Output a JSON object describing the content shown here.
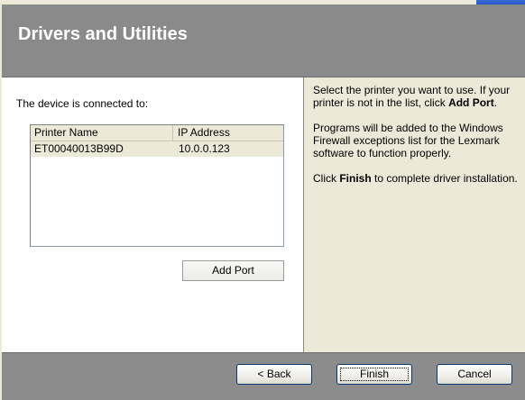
{
  "header": {
    "title": "Drivers and Utilities"
  },
  "left": {
    "connected_label": "The device is connected to:",
    "columns": {
      "name": "Printer Name",
      "ip": "IP Address"
    },
    "rows": [
      {
        "name": "ET00040013B99D",
        "ip": "10.0.0.123"
      }
    ],
    "add_port_label": "Add Port"
  },
  "right": {
    "p1_text": "Select the printer you want to use. If your printer is not in the list, click ",
    "p1_bold": "Add Port",
    "p1_end": ".",
    "p2_text": "Programs will be added to the Windows Firewall exceptions list for the Lexmark software to function properly.",
    "p3_start": "Click ",
    "p3_bold": "Finish",
    "p3_end": " to complete driver installation."
  },
  "footer": {
    "back_label": "< Back",
    "finish_label": "Finish",
    "cancel_label": "Cancel"
  },
  "colors": {
    "header_bg": "#8a8a8a",
    "footer_bg": "#8c8c8c",
    "panel_bg": "#ece9d8"
  }
}
